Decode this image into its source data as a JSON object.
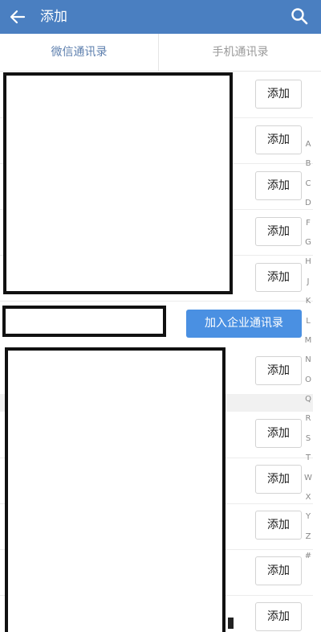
{
  "header": {
    "title": "添加",
    "back_icon": "arrow-left-icon",
    "search_icon": "search-icon",
    "bg_color": "#4a7fc1"
  },
  "tabs": [
    {
      "label": "微信通讯录",
      "active": true
    },
    {
      "label": "手机通讯录",
      "active": false
    }
  ],
  "contact_rows": [
    {
      "action_label": "添加"
    },
    {
      "action_label": "添加"
    },
    {
      "action_label": "添加"
    },
    {
      "action_label": "添加"
    },
    {
      "action_label": "添加"
    },
    {
      "action_label": "添加"
    },
    {
      "action_label": "添加"
    },
    {
      "action_label": "添加"
    },
    {
      "action_label": "添加"
    },
    {
      "action_label": "添加"
    },
    {
      "action_label": "添加"
    }
  ],
  "enterprise_button": {
    "label": "加入企业通讯录",
    "color": "#4a90e2"
  },
  "alphabet_index": [
    "A",
    "B",
    "C",
    "D",
    "F",
    "G",
    "H",
    "J",
    "K",
    "L",
    "M",
    "N",
    "O",
    "Q",
    "R",
    "S",
    "T",
    "W",
    "X",
    "Y",
    "Z",
    "#"
  ]
}
